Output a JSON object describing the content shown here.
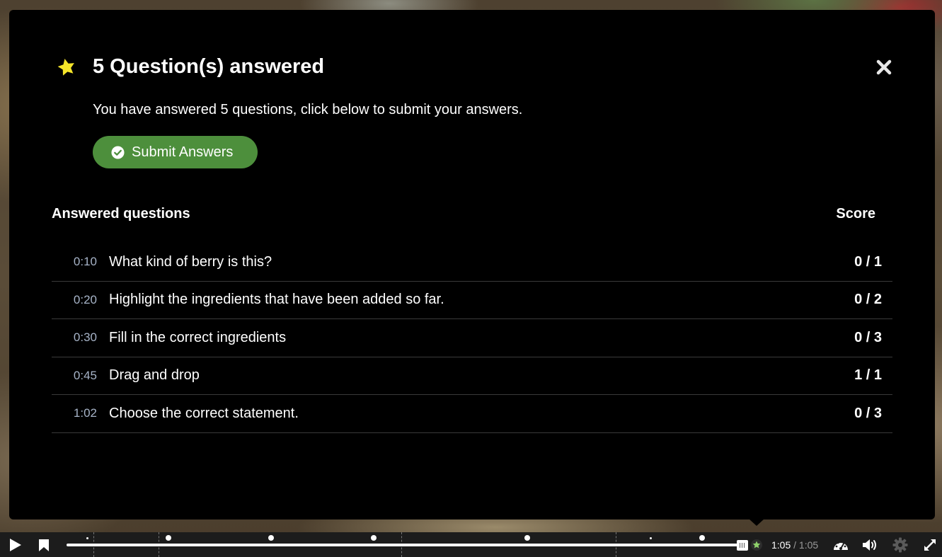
{
  "summary": {
    "title": "5 Question(s) answered",
    "message": "You have answered 5 questions, click below to submit your answers.",
    "submit_label": "Submit Answers",
    "table_header_questions": "Answered questions",
    "table_header_score": "Score",
    "rows": [
      {
        "time": "0:10",
        "question": "What kind of berry is this?",
        "score": "0 / 1"
      },
      {
        "time": "0:20",
        "question": "Highlight the ingredients that have been added so far.",
        "score": "0 / 2"
      },
      {
        "time": "0:30",
        "question": "Fill in the correct ingredients",
        "score": "0 / 3"
      },
      {
        "time": "0:45",
        "question": "Drag and drop",
        "score": "1 / 1"
      },
      {
        "time": "1:02",
        "question": "Choose the correct statement.",
        "score": "0 / 3"
      }
    ],
    "icons": {
      "header": "star-icon",
      "close": "close-icon",
      "submit": "check-circle-icon"
    },
    "colors": {
      "accent_star": "#f5e52a",
      "submit_green": "#4d8f3c",
      "time_text": "#a7b4c8"
    }
  },
  "player": {
    "current_time": "1:05",
    "separator": "/",
    "total_time": "1:05",
    "progress": 1.0,
    "icons": [
      "play-icon",
      "bookmark-icon",
      "endscreen-star-icon",
      "playback-speed-icon",
      "volume-icon",
      "settings-icon",
      "fullscreen-icon"
    ]
  }
}
